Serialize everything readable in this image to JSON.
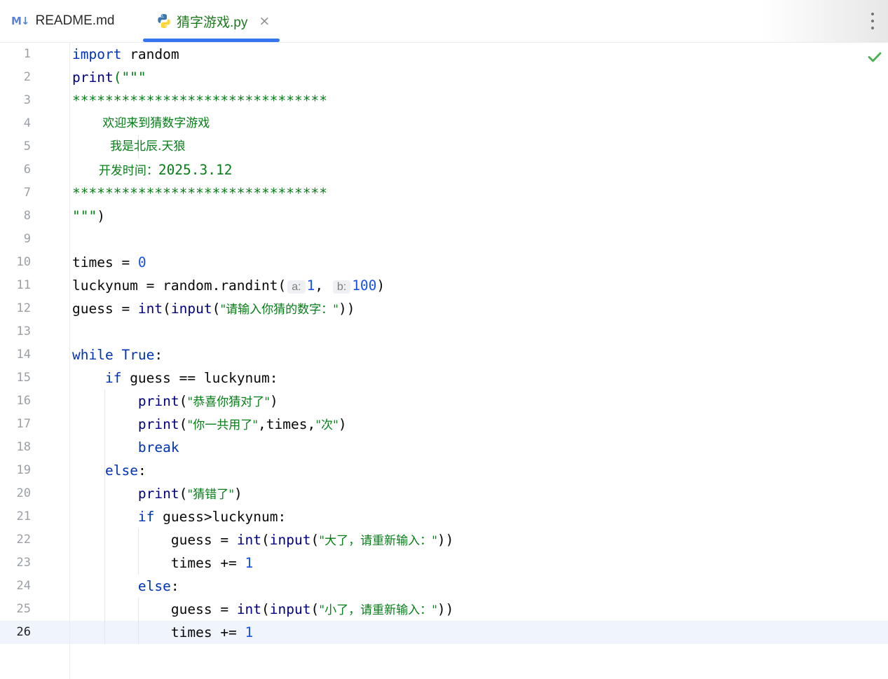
{
  "tabs": [
    {
      "icon": "markdown-icon",
      "icon_text": "M↓",
      "label": "README.md",
      "active": false
    },
    {
      "icon": "python-icon",
      "label": "猜字游戏.py",
      "active": true,
      "close": "×"
    }
  ],
  "colors": {
    "accent": "#3574f0",
    "keyword": "#0033b3",
    "string": "#067d17",
    "number": "#1750eb",
    "check": "#4caf50"
  },
  "editor": {
    "status": "check-icon",
    "current_line": 26,
    "lines": [
      {
        "n": "1"
      },
      {
        "n": "2"
      },
      {
        "n": "3"
      },
      {
        "n": "4"
      },
      {
        "n": "5"
      },
      {
        "n": "6"
      },
      {
        "n": "7"
      },
      {
        "n": "8"
      },
      {
        "n": "9"
      },
      {
        "n": "10"
      },
      {
        "n": "11"
      },
      {
        "n": "12"
      },
      {
        "n": "13"
      },
      {
        "n": "14"
      },
      {
        "n": "15"
      },
      {
        "n": "16"
      },
      {
        "n": "17"
      },
      {
        "n": "18"
      },
      {
        "n": "19"
      },
      {
        "n": "20"
      },
      {
        "n": "21"
      },
      {
        "n": "22"
      },
      {
        "n": "23"
      },
      {
        "n": "24"
      },
      {
        "n": "25"
      },
      {
        "n": "26"
      }
    ],
    "code": {
      "l1": [
        "import",
        " random"
      ],
      "l2": [
        "print",
        "(\"\"\""
      ],
      "l3": "*******************************",
      "l4": "        欢迎来到猜数字游戏",
      "l5": "          我是北辰.天狼",
      "l6": [
        "       开发时间：",
        "2025.3.12"
      ],
      "l7": "*******************************",
      "l8": [
        "\"\"\"",
        ")"
      ],
      "l10": [
        "times = ",
        "0"
      ],
      "l11": [
        "luckynum = random.randint(",
        "a:",
        "1",
        ",",
        "b:",
        "100",
        ")"
      ],
      "l12": [
        "guess = ",
        "int",
        "(",
        "input",
        "(",
        "\"请输入你猜的数字：\"",
        "))"
      ],
      "l14": [
        "while",
        " ",
        "True",
        ":"
      ],
      "l15": [
        "    ",
        "if",
        " guess == luckynum:"
      ],
      "l16": [
        "        ",
        "print",
        "(",
        "\"恭喜你猜对了\"",
        ")"
      ],
      "l17": [
        "        ",
        "print",
        "(",
        "\"你一共用了\"",
        ",times,",
        "\"次\"",
        ")"
      ],
      "l18": [
        "        ",
        "break"
      ],
      "l19": [
        "    ",
        "else",
        ":"
      ],
      "l20": [
        "        ",
        "print",
        "(",
        "\"猜错了\"",
        ")"
      ],
      "l21": [
        "        ",
        "if",
        " guess>luckynum:"
      ],
      "l22": [
        "            guess = ",
        "int",
        "(",
        "input",
        "(",
        "\"大了，请重新输入：\"",
        "))"
      ],
      "l23": [
        "            times += ",
        "1"
      ],
      "l24": [
        "        ",
        "else",
        ":"
      ],
      "l25": [
        "            guess = ",
        "int",
        "(",
        "input",
        "(",
        "\"小了，请重新输入：\"",
        "))"
      ],
      "l26": [
        "            times += ",
        "1"
      ]
    }
  }
}
